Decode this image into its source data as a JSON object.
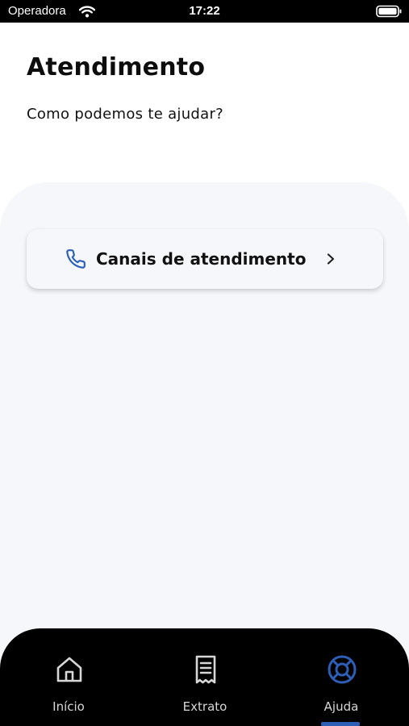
{
  "status_bar": {
    "carrier": "Operadora",
    "time": "17:22",
    "wifi_icon": "wifi-icon",
    "battery_icon": "battery-icon"
  },
  "header": {
    "title": "Atendimento",
    "subtitle": "Como podemos te ajudar?"
  },
  "main": {
    "cards": [
      {
        "label": "Canais de atendimento",
        "icon": "phone-icon",
        "trailing_icon": "chevron-right-icon"
      }
    ]
  },
  "bottom_nav": {
    "items": [
      {
        "label": "Início",
        "icon": "home-icon",
        "active": false
      },
      {
        "label": "Extrato",
        "icon": "receipt-icon",
        "active": false
      },
      {
        "label": "Ajuda",
        "icon": "lifebuoy-icon",
        "active": true
      }
    ]
  },
  "colors": {
    "accent": "#2d5fb7",
    "nav_background": "#000000",
    "panel_background": "#f6f7fa"
  }
}
